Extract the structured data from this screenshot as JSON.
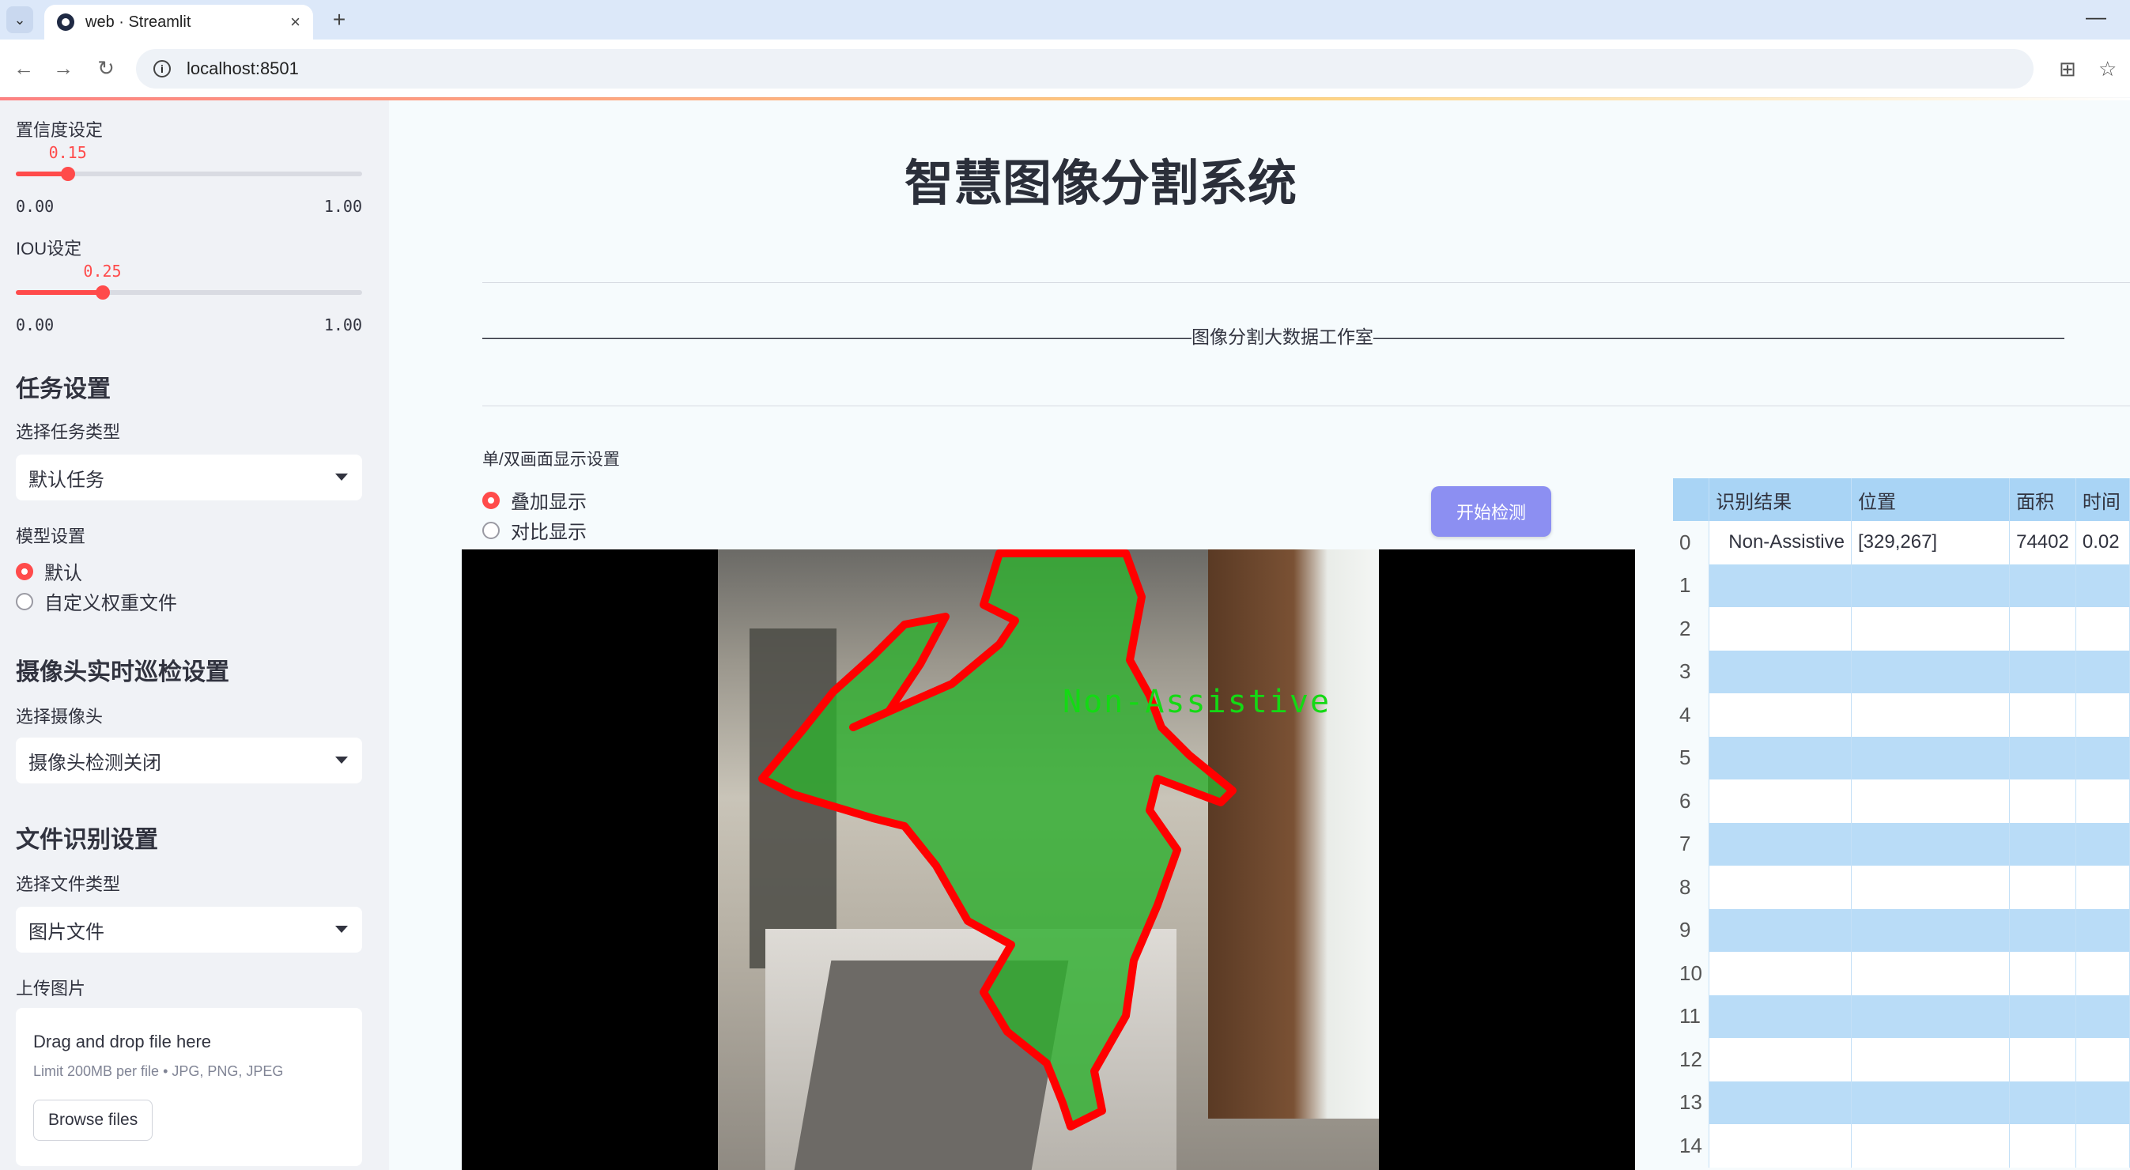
{
  "browser": {
    "tab_title": "web · Streamlit",
    "url": "localhost:8501",
    "new_tab": "+",
    "close": "×",
    "minimize": "—"
  },
  "sidebar": {
    "confidence": {
      "label": "置信度设定",
      "value": 0.15,
      "value_text": "0.15",
      "min": "0.00",
      "max": "1.00"
    },
    "iou": {
      "label": "IOU设定",
      "value": 0.25,
      "value_text": "0.25",
      "min": "0.00",
      "max": "1.00"
    },
    "task_section": "任务设置",
    "task_type_label": "选择任务类型",
    "task_type_value": "默认任务",
    "model_label": "模型设置",
    "model_options": [
      "默认",
      "自定义权重文件"
    ],
    "model_selected": 0,
    "camera_section": "摄像头实时巡检设置",
    "camera_label": "选择摄像头",
    "camera_value": "摄像头检测关闭",
    "file_section": "文件识别设置",
    "file_type_label": "选择文件类型",
    "file_type_value": "图片文件",
    "upload_label": "上传图片",
    "upload_main": "Drag and drop file here",
    "upload_sub": "Limit 200MB per file • JPG, PNG, JPEG",
    "browse_label": "Browse files"
  },
  "main": {
    "title": "智慧图像分割系统",
    "banner": "———————————————————————————————————————图像分割大数据工作室——————————————————————————————————————",
    "display_label": "单/双画面显示设置",
    "display_options": [
      "叠加显示",
      "对比显示"
    ],
    "display_selected": 0,
    "start_button": "开始检测",
    "detection_label": "Non-Assistive"
  },
  "table": {
    "columns": [
      "识别结果",
      "位置",
      "面积",
      "时间"
    ],
    "rows": [
      {
        "idx": "0",
        "result": "Non-Assistive",
        "position": "[329,267]",
        "area": "74402",
        "time": "0.02"
      },
      {
        "idx": "1"
      },
      {
        "idx": "2"
      },
      {
        "idx": "3"
      },
      {
        "idx": "4"
      },
      {
        "idx": "5"
      },
      {
        "idx": "6"
      },
      {
        "idx": "7"
      },
      {
        "idx": "8"
      },
      {
        "idx": "9"
      },
      {
        "idx": "10"
      },
      {
        "idx": "11"
      },
      {
        "idx": "12"
      },
      {
        "idx": "13"
      },
      {
        "idx": "14"
      }
    ]
  },
  "colors": {
    "accent": "#ff4b4b",
    "button": "#8c8ff2",
    "mask_fill": "#2fae2f",
    "mask_outline": "#ff0000",
    "table_header": "#a9d4f5",
    "table_stripe": "#b9dcf7"
  },
  "icons": [
    "tab-menu-icon",
    "streamlit-favicon",
    "back-icon",
    "forward-icon",
    "reload-icon",
    "info-icon",
    "translate-icon",
    "star-icon",
    "chevron-down-icon"
  ]
}
